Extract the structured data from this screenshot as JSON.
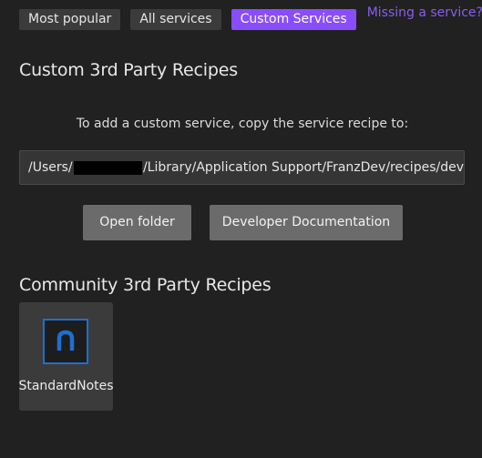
{
  "tabs": [
    {
      "label": "Most popular",
      "active": false
    },
    {
      "label": "All services",
      "active": false
    },
    {
      "label": "Custom Services",
      "active": true
    }
  ],
  "missing_link": {
    "label": "Missing a service?",
    "icon": "external-link-icon",
    "color": "#8a5cf0"
  },
  "custom": {
    "heading": "Custom 3rd Party Recipes",
    "instruction": "To add a custom service, copy the service recipe to:",
    "path_prefix": "/Users/",
    "path_suffix": "/Library/Application Support/FranzDev/recipes/dev",
    "open_folder_label": "Open folder",
    "docs_label": "Developer Documentation"
  },
  "community": {
    "heading": "Community 3rd Party Recipes",
    "recipes": [
      {
        "name": "StandardNotes",
        "icon": "standardnotes-logo-icon"
      }
    ]
  },
  "colors": {
    "background": "#212121",
    "accent": "#8a4dfb",
    "tab_bg": "#3b3b3b",
    "button_bg": "#6b6b6b",
    "logo_blue": "#1e6fd0"
  }
}
